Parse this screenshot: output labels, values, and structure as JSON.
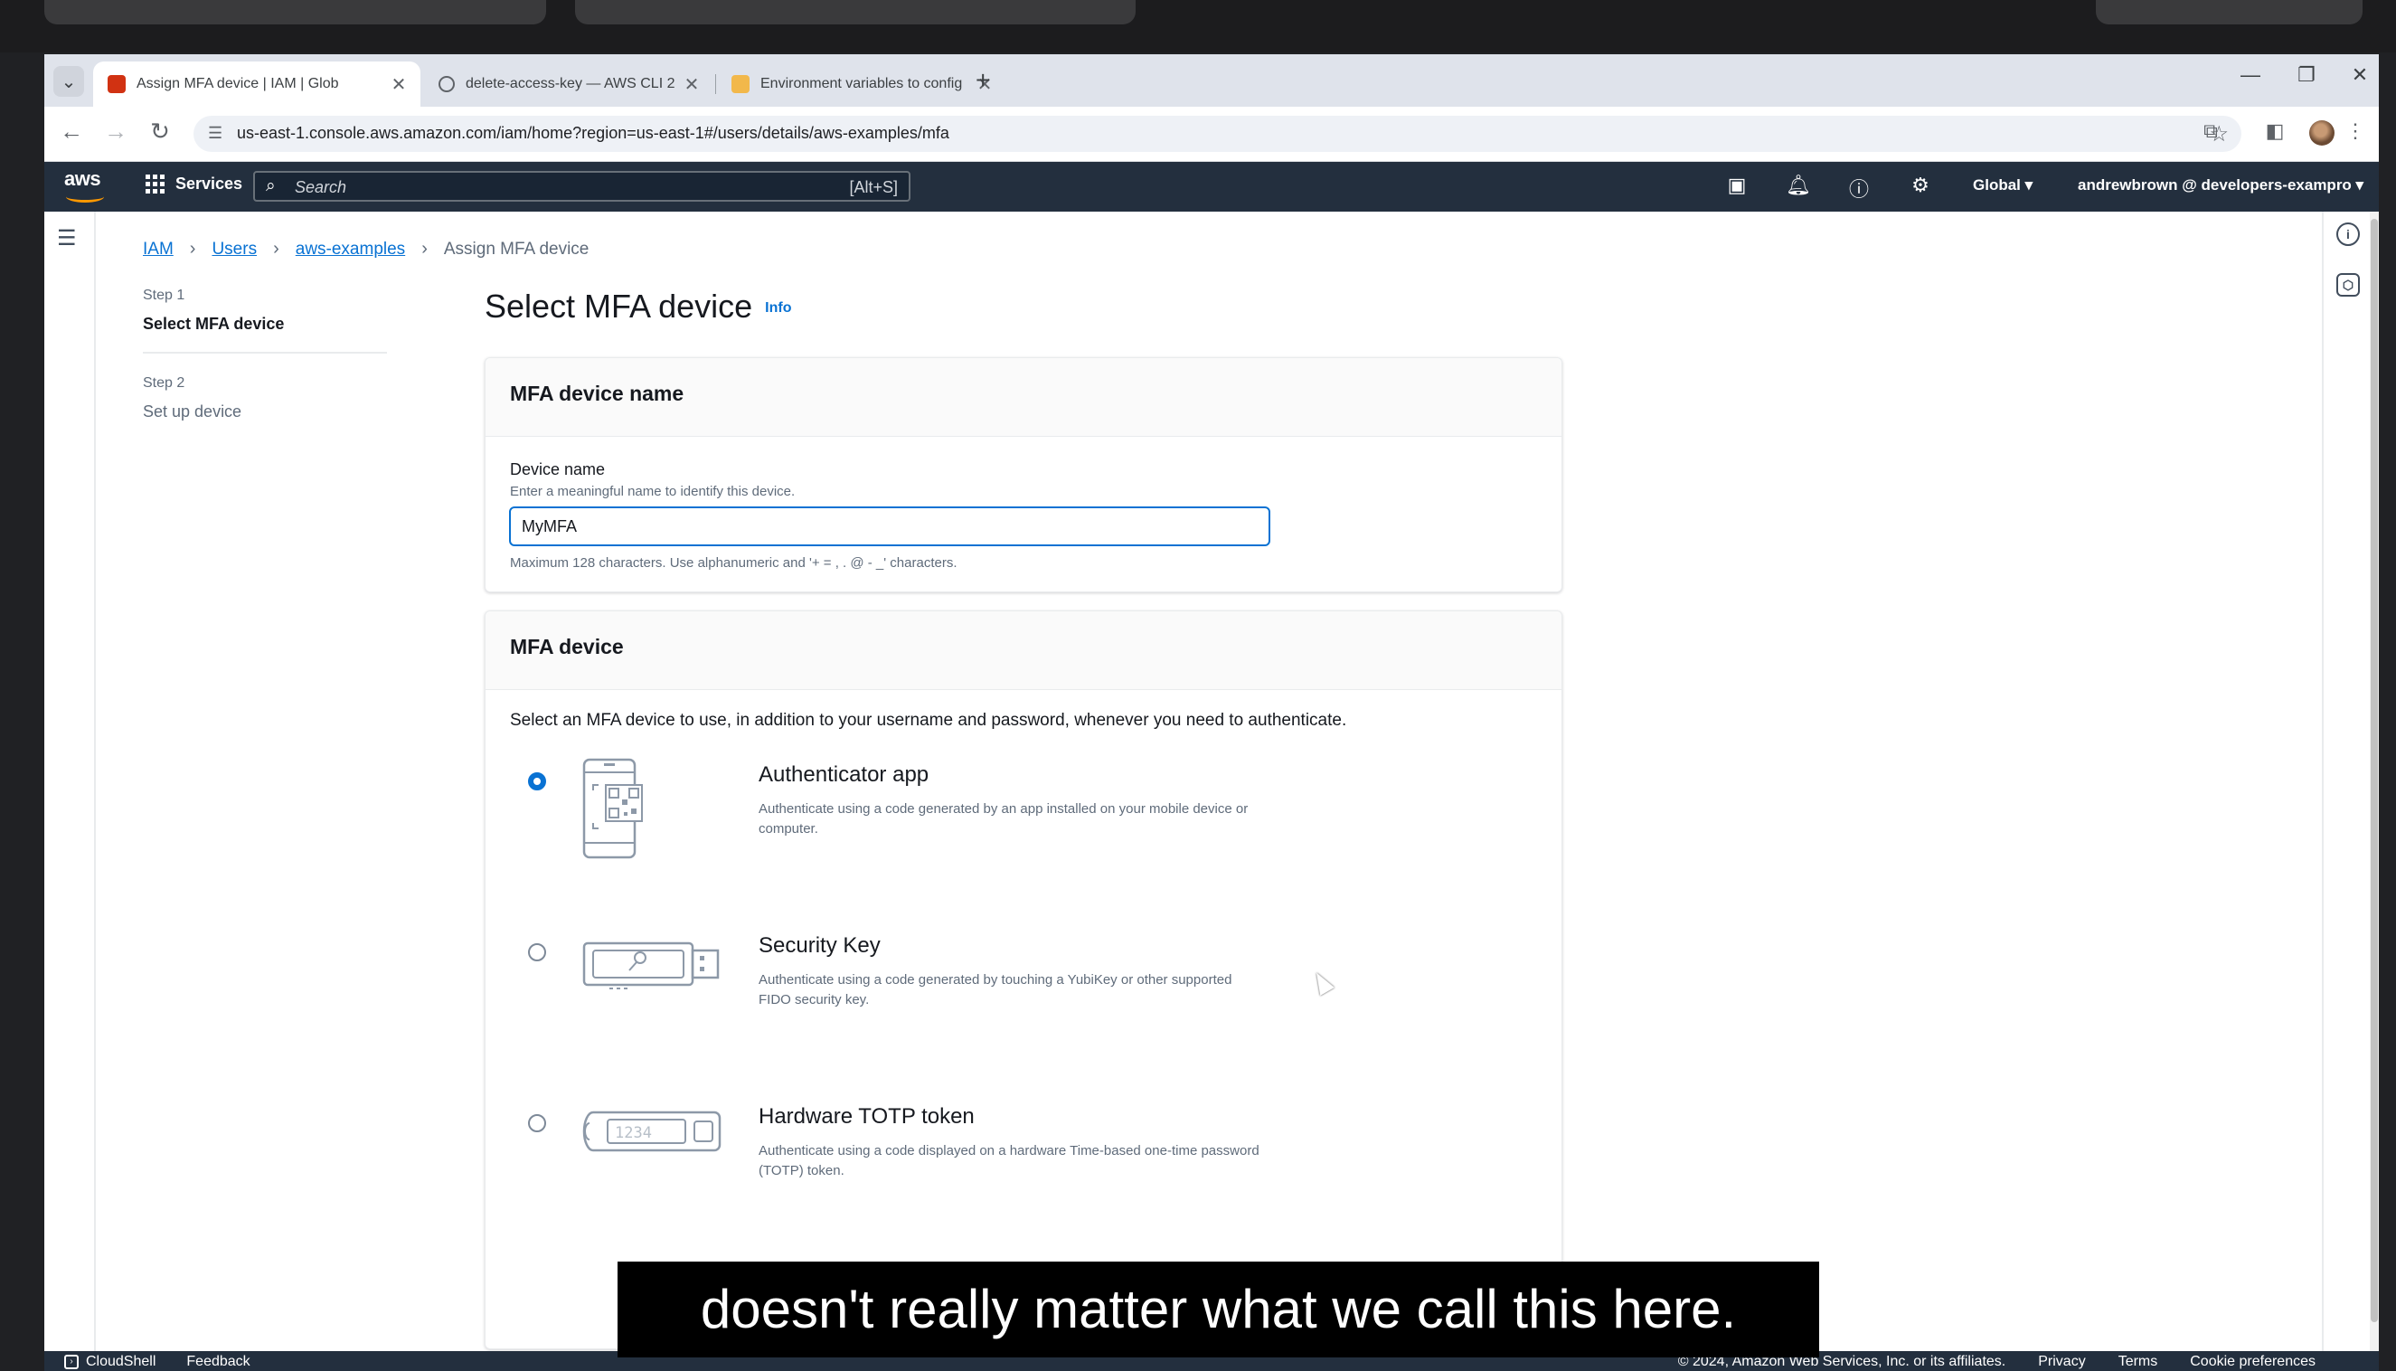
{
  "browser": {
    "tabs": [
      {
        "title": "Assign MFA device | IAM | Glob",
        "active": true
      },
      {
        "title": "delete-access-key — AWS CLI 2",
        "active": false
      },
      {
        "title": "Environment variables to config",
        "active": false
      }
    ],
    "url": "us-east-1.console.aws.amazon.com/iam/home?region=us-east-1#/users/details/aws-examples/mfa"
  },
  "aws_nav": {
    "services_label": "Services",
    "search_placeholder": "Search",
    "search_shortcut": "[Alt+S]",
    "region": "Global ▾",
    "account": "andrewbrown @ developers-exampro ▾"
  },
  "breadcrumb": {
    "items": [
      "IAM",
      "Users",
      "aws-examples"
    ],
    "current": "Assign MFA device"
  },
  "steps": [
    {
      "label": "Step 1",
      "name": "Select MFA device"
    },
    {
      "label": "Step 2",
      "name": "Set up device"
    }
  ],
  "page": {
    "title": "Select MFA device",
    "info": "Info"
  },
  "device_name_card": {
    "heading": "MFA device name",
    "field_label": "Device name",
    "field_description": "Enter a meaningful name to identify this device.",
    "value": "MyMFA",
    "constraint": "Maximum 128 characters. Use alphanumeric and '+ = , . @ - _' characters."
  },
  "mfa_device_card": {
    "heading": "MFA device",
    "intro": "Select an MFA device to use, in addition to your username and password, whenever you need to authenticate.",
    "options": [
      {
        "title": "Authenticator app",
        "description": "Authenticate using a code generated by an app installed on your mobile device or computer.",
        "selected": true,
        "icon": "phone-qr-icon"
      },
      {
        "title": "Security Key",
        "description": "Authenticate using a code generated by touching a YubiKey or other supported FIDO security key.",
        "selected": false,
        "icon": "usb-key-icon"
      },
      {
        "title": "Hardware TOTP token",
        "description": "Authenticate using a code displayed on a hardware Time-based one-time password (TOTP) token.",
        "selected": false,
        "icon": "totp-token-icon"
      }
    ],
    "token_display": "1234"
  },
  "footer": {
    "cloudshell": "CloudShell",
    "feedback": "Feedback",
    "copyright": "© 2024, Amazon Web Services, Inc. or its affiliates.",
    "links": [
      "Privacy",
      "Terms",
      "Cookie preferences"
    ]
  },
  "caption": "doesn't really matter what we call this here.",
  "colors": {
    "aws_nav": "#232f3e",
    "link_blue": "#0972d3",
    "aws_orange": "#ff9900"
  }
}
